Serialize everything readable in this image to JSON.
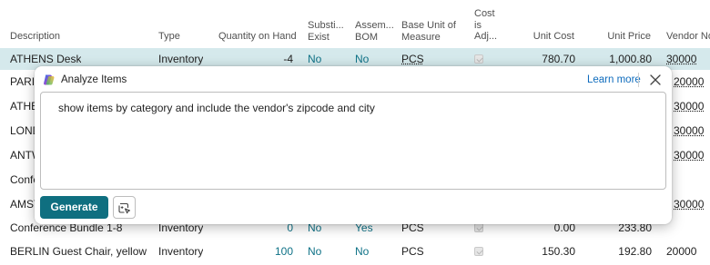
{
  "columns": {
    "description": "Description",
    "type": "Type",
    "quantity_on_hand": "Quantity on Hand",
    "substitutes_exist": [
      "Substi...",
      "Exist"
    ],
    "assembly_bom": [
      "Assem...",
      "BOM"
    ],
    "base_unit": [
      "Base Unit of",
      "Measure"
    ],
    "cost_is_adjusted": [
      "Cost",
      "is",
      "Adj..."
    ],
    "unit_cost": "Unit Cost",
    "unit_price": "Unit Price",
    "vendor_no": "Vendor No."
  },
  "rows": [
    {
      "description": "ATHENS Desk",
      "type": "Inventory",
      "qty": "-4",
      "subst": "No",
      "bom": "No",
      "unit": "PCS",
      "cost": "780.70",
      "price": "1,000.80",
      "vendor": "30000",
      "selected": true
    },
    {
      "description": "PARIS",
      "vendor": "20000"
    },
    {
      "description": "ATHE",
      "vendor": "30000"
    },
    {
      "description": "LOND",
      "vendor": "30000"
    },
    {
      "description": "ANTW",
      "vendor": "30000"
    },
    {
      "description": "Confe",
      "vendor": ""
    },
    {
      "description": "AMST",
      "vendor": "30000"
    },
    {
      "description": "Conference Bundle 1-8",
      "type": "Inventory",
      "qty": "0",
      "subst": "No",
      "bom": "Yes",
      "unit": "PCS",
      "cost": "0.00",
      "price": "233.80",
      "vendor": ""
    },
    {
      "description": "BERLIN Guest Chair, yellow",
      "type": "Inventory",
      "qty": "100",
      "subst": "No",
      "bom": "No",
      "unit": "PCS",
      "cost": "150.30",
      "price": "192.80",
      "vendor": "20000"
    }
  ],
  "dialog": {
    "title": "Analyze Items",
    "learn_more": "Learn more",
    "prompt_text": "show items by category and include the vendor's zipcode and city",
    "generate_label": "Generate"
  },
  "colors": {
    "accent": "#0f6f80",
    "link": "#0f7287",
    "selected_row": "#d5e9ec"
  },
  "icons": {
    "dialog": "copilot-icon",
    "close": "close-icon",
    "prompt_guide": "prompt-guide-icon"
  }
}
